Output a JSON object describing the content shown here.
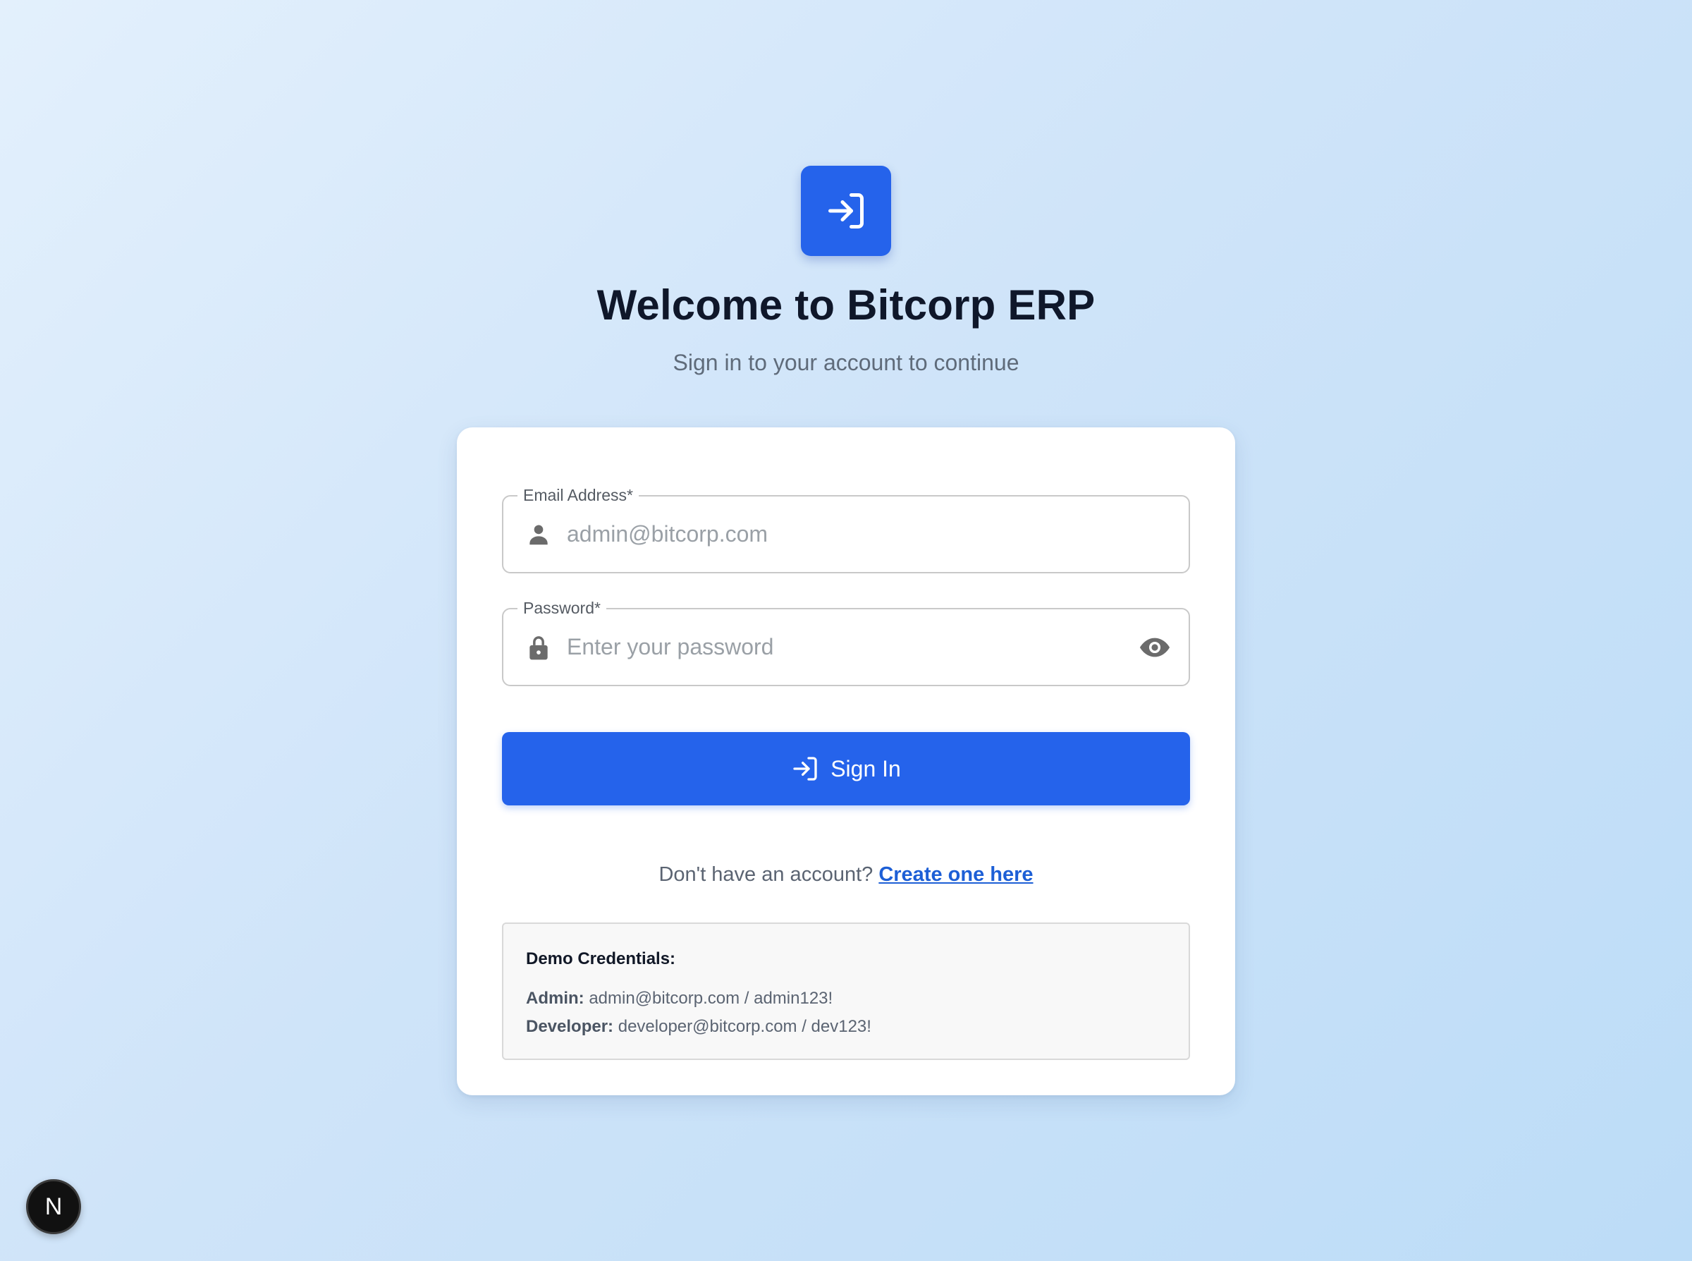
{
  "header": {
    "logo_icon": "login-icon",
    "title": "Welcome to Bitcorp ERP",
    "subtitle": "Sign in to your account to continue"
  },
  "form": {
    "email": {
      "label": "Email Address*",
      "placeholder": "admin@bitcorp.com",
      "value": "",
      "icon": "person-icon"
    },
    "password": {
      "label": "Password*",
      "placeholder": "Enter your password",
      "value": "",
      "icon": "lock-icon",
      "toggle_icon": "eye-icon"
    },
    "submit": {
      "label": "Sign In",
      "icon": "login-icon"
    }
  },
  "register": {
    "prompt": "Don't have an account?",
    "link_label": "Create one here"
  },
  "demo": {
    "title": "Demo Credentials:",
    "rows": [
      {
        "role": "Admin:",
        "credentials": "admin@bitcorp.com / admin123!"
      },
      {
        "role": "Developer:",
        "credentials": "developer@bitcorp.com / dev123!"
      }
    ]
  },
  "dev_badge": {
    "letter": "N"
  },
  "colors": {
    "primary": "#2563eb",
    "link": "#1d5fd6",
    "background_start": "#e3f0fc",
    "background_end": "#bcdcf7"
  }
}
